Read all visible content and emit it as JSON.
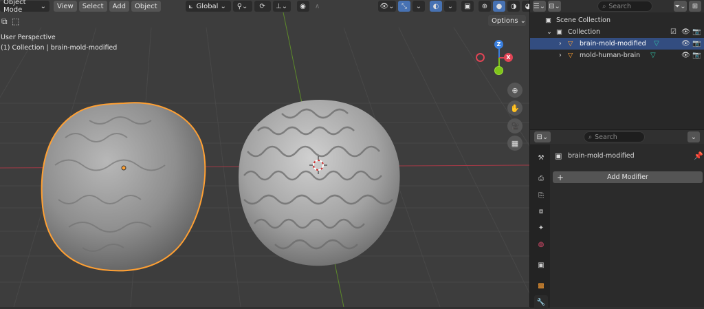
{
  "header": {
    "mode": "Object Mode",
    "menus": [
      "View",
      "Select",
      "Add",
      "Object"
    ],
    "transform_orientation": "Global",
    "options": "Options"
  },
  "viewport": {
    "perspective": "User Perspective",
    "context": "(1) Collection | brain-mold-modified",
    "gizmo": {
      "z": "Z",
      "x": "X",
      "y": "Y"
    }
  },
  "outliner": {
    "search_placeholder": "Search",
    "scene_collection": "Scene Collection",
    "collection": "Collection",
    "objects": [
      {
        "name": "brain-mold-modified",
        "selected": true
      },
      {
        "name": "mold-human-brain",
        "selected": false
      }
    ]
  },
  "properties": {
    "search_placeholder": "Search",
    "object_name": "brain-mold-modified",
    "add_modifier": "Add Modifier"
  },
  "colors": {
    "selection_outline": "#ffa033",
    "axis_x": "#e04455",
    "axis_y": "#7fc41a",
    "axis_z": "#3a80e0"
  }
}
